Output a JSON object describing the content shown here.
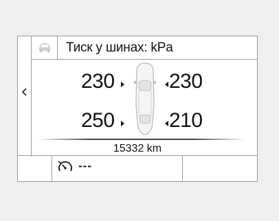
{
  "header": {
    "title": "Тиск у шинах: kPa",
    "icon": "car-icon"
  },
  "back_button": {
    "icon": "chevron-left-icon"
  },
  "tires": {
    "front_left": "230",
    "front_right": "230",
    "rear_left": "250",
    "rear_right": "210"
  },
  "vehicle_icon": "car-top-view-icon",
  "odometer": "15332 km",
  "bottom_bar": {
    "trip_icon": "speedometer-icon",
    "trip_value": "---"
  },
  "colors": {
    "background": "#efefef",
    "panel": "#ffffff",
    "border": "#9a9a9a",
    "text": "#111111"
  }
}
